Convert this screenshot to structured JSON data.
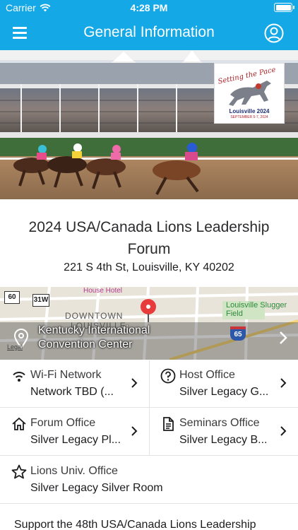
{
  "status_bar": {
    "carrier": "Carrier",
    "time": "4:28 PM"
  },
  "nav": {
    "title": "General Information"
  },
  "hero": {
    "logo_title": "Setting the Pace",
    "logo_city": "Louisville 2024",
    "logo_dates": "SEPTEMBER 5-7, 2024"
  },
  "event": {
    "title": "2024 USA/Canada Lions Leadership Forum",
    "address": "221 S 4th St, Louisville, KY 40202"
  },
  "map": {
    "venue": "Kentucky International Convention Center",
    "legal": "Legal",
    "labels": {
      "house_hotel": "House Hotel",
      "downtown": "DOWNTOWN",
      "louisville": "LOUISVILLE",
      "slugger": "Louisville Slugger Field",
      "shield_60": "60",
      "shield_31w": "31W",
      "shield_65": "65"
    }
  },
  "info": [
    {
      "icon": "wifi-icon",
      "title": "Wi-Fi Network",
      "value": "Network TBD (..."
    },
    {
      "icon": "question-circle-icon",
      "title": "Host Office",
      "value": "Silver Legacy G..."
    },
    {
      "icon": "home-icon",
      "title": "Forum Office",
      "value": "Silver Legacy Pl..."
    },
    {
      "icon": "document-icon",
      "title": "Seminars Office",
      "value": "Silver Legacy B..."
    },
    {
      "icon": "star-icon",
      "title": "Lions Univ. Office",
      "value": "Silver Legacy Silver Room"
    }
  ],
  "support_text": "Support the 48th USA/Canada Lions Leadership",
  "colors": {
    "nav_blue": "#14a8e6",
    "divider": "#e3e3e6"
  }
}
